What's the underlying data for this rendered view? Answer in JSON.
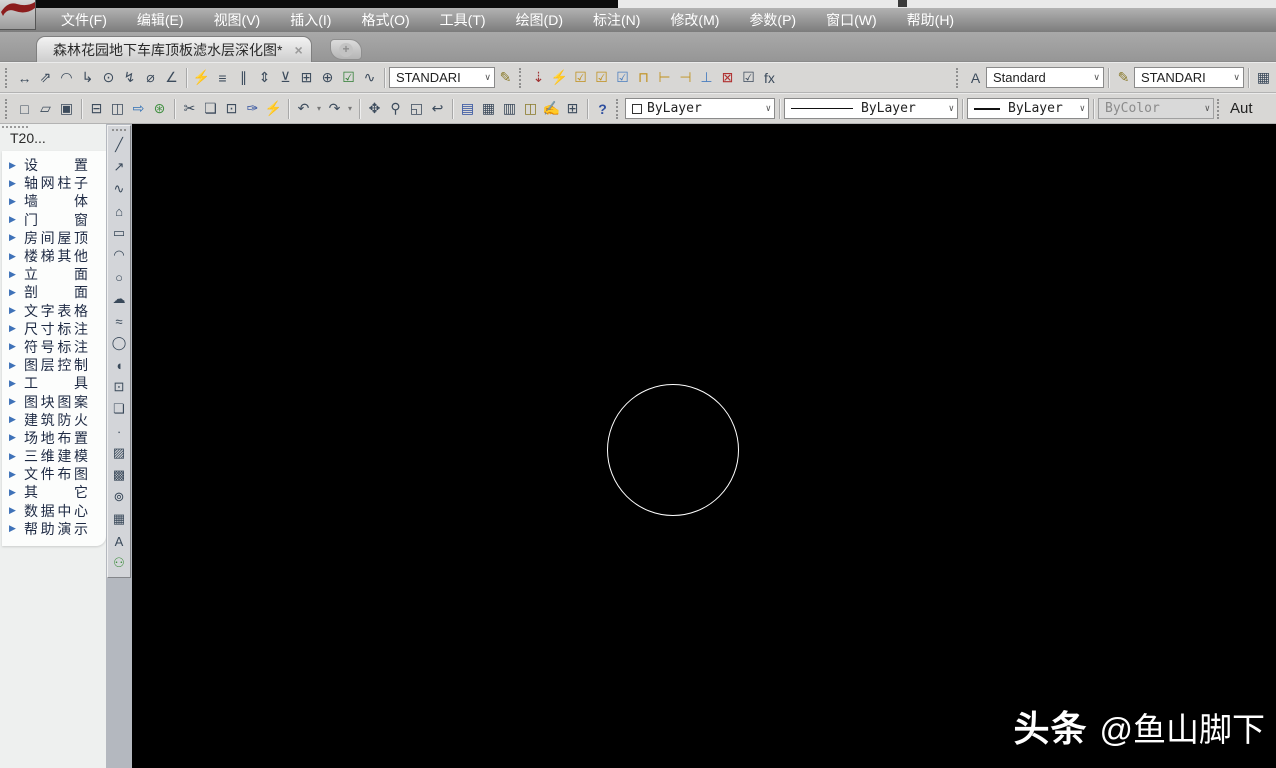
{
  "ui": {
    "chevron": "∨",
    "dropdown_arrow": "▾",
    "tab_close": "×",
    "new_tab_plus": "+",
    "menu_arrow": "▶",
    "help_glyph": "?"
  },
  "menu": {
    "items": [
      {
        "name": "file",
        "label": "文件(F)"
      },
      {
        "name": "edit",
        "label": "编辑(E)"
      },
      {
        "name": "view",
        "label": "视图(V)"
      },
      {
        "name": "insert",
        "label": "插入(I)"
      },
      {
        "name": "format",
        "label": "格式(O)"
      },
      {
        "name": "tools",
        "label": "工具(T)"
      },
      {
        "name": "draw",
        "label": "绘图(D)"
      },
      {
        "name": "dimension",
        "label": "标注(N)"
      },
      {
        "name": "modify",
        "label": "修改(M)"
      },
      {
        "name": "parametric",
        "label": "参数(P)"
      },
      {
        "name": "window",
        "label": "窗口(W)"
      },
      {
        "name": "help",
        "label": "帮助(H)"
      }
    ]
  },
  "tab_bar": {
    "active_tab": "森林花园地下车库顶板滤水层深化图*"
  },
  "toolbar_row1": {
    "dim_icons_a": [
      {
        "name": "linear-dimension",
        "glyph": "↔"
      },
      {
        "name": "aligned-dimension",
        "glyph": "⇗"
      },
      {
        "name": "arc-length-dimension",
        "glyph": "◠"
      },
      {
        "name": "ordinate-dimension",
        "glyph": "↳"
      },
      {
        "name": "radius-dimension",
        "glyph": "⊙"
      },
      {
        "name": "jogged-dimension",
        "glyph": "↯"
      },
      {
        "name": "diameter-dimension",
        "glyph": "⌀"
      },
      {
        "name": "angular-dimension",
        "glyph": "∠"
      }
    ],
    "dim_icons_b": [
      {
        "name": "quick-dimension",
        "glyph": "⚡",
        "color": "#c0901c"
      },
      {
        "name": "baseline-dimension",
        "glyph": "≡"
      },
      {
        "name": "continue-dimension",
        "glyph": "∥"
      },
      {
        "name": "dimension-space",
        "glyph": "⇕"
      },
      {
        "name": "dimension-break",
        "glyph": "⊻"
      },
      {
        "name": "tolerance",
        "glyph": "⊞"
      },
      {
        "name": "center-mark",
        "glyph": "⊕"
      },
      {
        "name": "inspect-dimension",
        "glyph": "☑",
        "color": "#2e7d32"
      },
      {
        "name": "jogged-linear",
        "glyph": "∿"
      }
    ],
    "dim_style_select": "STANDARI",
    "dim_style_edit_glyph": "✎",
    "constraint_icons": [
      {
        "name": "auto-constrain",
        "glyph": "⇣",
        "color": "#a03434"
      },
      {
        "name": "constraint-bar",
        "glyph": "⚡",
        "color": "#c0901c"
      },
      {
        "name": "show-constraints",
        "glyph": "☑",
        "color": "#c0901c"
      },
      {
        "name": "show-all-constraints",
        "glyph": "☑",
        "color": "#c0901c"
      },
      {
        "name": "hide-all-constraints",
        "glyph": "☑",
        "color": "#4a7ebf"
      },
      {
        "name": "lock-constraint",
        "glyph": "⊓",
        "color": "#c0901c"
      },
      {
        "name": "linear-constraint",
        "glyph": "⊢",
        "color": "#c0901c"
      },
      {
        "name": "aligned-constraint",
        "glyph": "⊣",
        "color": "#c0901c"
      },
      {
        "name": "radius-constraint",
        "glyph": "⊥",
        "color": "#4a7ebf"
      },
      {
        "name": "delete-constraints",
        "glyph": "⊠",
        "color": "#b03030"
      },
      {
        "name": "constraint-settings",
        "glyph": "☑"
      },
      {
        "name": "parameters-manager",
        "glyph": "fx"
      }
    ],
    "text_style_glyph": "A",
    "text_style_select": "Standard",
    "dim_style2_glyph": "✎",
    "dim_style2_select": "STANDARI",
    "table_style_glyph": "▦"
  },
  "toolbar_row2": {
    "file_icons": [
      {
        "name": "new-file",
        "glyph": "□"
      },
      {
        "name": "open-file",
        "glyph": "▱"
      },
      {
        "name": "save-file",
        "glyph": "▣"
      }
    ],
    "print_icons": [
      {
        "name": "plot",
        "glyph": "⊟"
      },
      {
        "name": "plot-preview",
        "glyph": "◫"
      },
      {
        "name": "publish",
        "glyph": "⇨",
        "color": "#2f6fb5"
      },
      {
        "name": "web-publish",
        "glyph": "⊛",
        "color": "#3f8f3f"
      }
    ],
    "edit_icons": [
      {
        "name": "cut",
        "glyph": "✂"
      },
      {
        "name": "copy",
        "glyph": "❏"
      },
      {
        "name": "paste",
        "glyph": "⊡"
      },
      {
        "name": "match-properties",
        "glyph": "✑",
        "color": "#2f4f9f"
      },
      {
        "name": "block-editor",
        "glyph": "⚡",
        "color": "#c0901c"
      }
    ],
    "undo_glyph": "↶",
    "redo_glyph": "↷",
    "view_icons": [
      {
        "name": "pan",
        "glyph": "✥"
      },
      {
        "name": "zoom-realtime",
        "glyph": "⚲"
      },
      {
        "name": "zoom-window",
        "glyph": "◱"
      },
      {
        "name": "zoom-previous",
        "glyph": "↩"
      }
    ],
    "palette_icons": [
      {
        "name": "properties-palette",
        "glyph": "▤",
        "color": "#2f4f9f"
      },
      {
        "name": "design-center",
        "glyph": "▦"
      },
      {
        "name": "tool-palettes",
        "glyph": "▥"
      },
      {
        "name": "sheet-set-manager",
        "glyph": "◫",
        "color": "#8a7a2a"
      },
      {
        "name": "markup-set-manager",
        "glyph": "✍"
      },
      {
        "name": "quick-calc",
        "glyph": "⊞"
      }
    ],
    "color_control": {
      "value": "ByLayer"
    },
    "linetype_control": {
      "value": "ByLayer"
    },
    "lineweight_control": {
      "value": "ByLayer"
    },
    "plotstyle_control": {
      "value": "ByColor"
    },
    "workspace_clipped": "Aut"
  },
  "sidebar": {
    "title": "T20...",
    "items": [
      {
        "name": "settings",
        "label": "设置"
      },
      {
        "name": "axis-grid-column",
        "label": "轴网柱子"
      },
      {
        "name": "wall",
        "label": "墙体"
      },
      {
        "name": "door-window",
        "label": "门窗"
      },
      {
        "name": "room-roof",
        "label": "房间屋顶"
      },
      {
        "name": "stair-other",
        "label": "楼梯其他"
      },
      {
        "name": "elevation",
        "label": "立面"
      },
      {
        "name": "section",
        "label": "剖面"
      },
      {
        "name": "text-table",
        "label": "文字表格"
      },
      {
        "name": "dimension",
        "label": "尺寸标注"
      },
      {
        "name": "symbol-annotation",
        "label": "符号标注"
      },
      {
        "name": "layer-control",
        "label": "图层控制"
      },
      {
        "name": "tools",
        "label": "工具"
      },
      {
        "name": "block-pattern",
        "label": "图块图案"
      },
      {
        "name": "fire-protection",
        "label": "建筑防火"
      },
      {
        "name": "site-layout",
        "label": "场地布置"
      },
      {
        "name": "3d-modeling",
        "label": "三维建模"
      },
      {
        "name": "file-layout",
        "label": "文件布图"
      },
      {
        "name": "others",
        "label": "其它"
      },
      {
        "name": "data-center",
        "label": "数据中心"
      },
      {
        "name": "help-demo",
        "label": "帮助演示"
      }
    ]
  },
  "draw_toolbar": {
    "icons": [
      {
        "name": "line",
        "glyph": "╱"
      },
      {
        "name": "construction-line",
        "glyph": "↗"
      },
      {
        "name": "polyline",
        "glyph": "∿"
      },
      {
        "name": "polygon",
        "glyph": "⌂"
      },
      {
        "name": "rectangle",
        "glyph": "▭"
      },
      {
        "name": "arc",
        "glyph": "◠"
      },
      {
        "name": "circle",
        "glyph": "○"
      },
      {
        "name": "revision-cloud",
        "glyph": "☁"
      },
      {
        "name": "spline",
        "glyph": "≈"
      },
      {
        "name": "ellipse",
        "glyph": "◯"
      },
      {
        "name": "ellipse-arc",
        "glyph": "◖"
      },
      {
        "name": "insert-block",
        "glyph": "⊡"
      },
      {
        "name": "make-block",
        "glyph": "❏"
      },
      {
        "name": "point",
        "glyph": "∙"
      },
      {
        "name": "hatch",
        "glyph": "▨"
      },
      {
        "name": "gradient",
        "glyph": "▩"
      },
      {
        "name": "region",
        "glyph": "⊚"
      },
      {
        "name": "table",
        "glyph": "▦"
      },
      {
        "name": "multiline-text",
        "glyph": "A"
      },
      {
        "name": "add-selected",
        "glyph": "⚇",
        "color": "#3f8f3f"
      }
    ]
  },
  "canvas": {
    "watermark_brand": "头条",
    "watermark_handle": "@鱼山脚下"
  }
}
